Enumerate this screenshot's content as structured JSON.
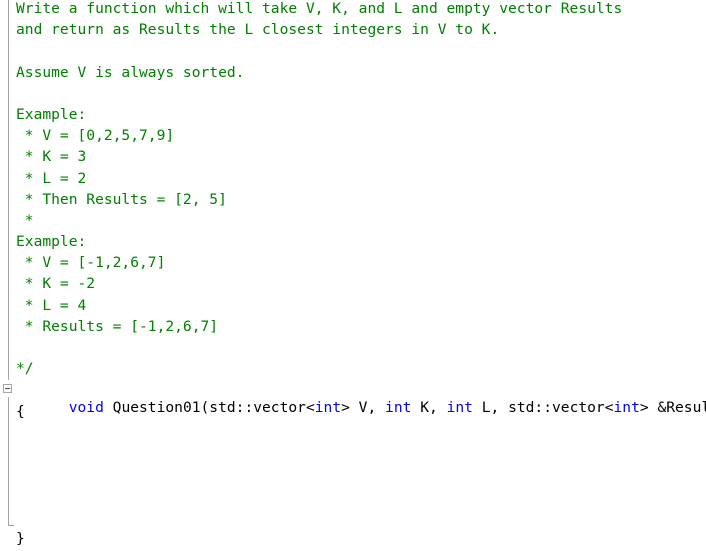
{
  "comment": {
    "lines": [
      "Write a function which will take V, K, and L and empty vector Results",
      "and return as Results the L closest integers in V to K.",
      "",
      "Assume V is always sorted.",
      "",
      "Example:",
      " * V = [0,2,5,7,9]",
      " * K = 3",
      " * L = 2",
      " * Then Results = [2, 5]",
      " *",
      "Example:",
      " * V = [-1,2,6,7]",
      " * K = -2",
      " * L = 4",
      " * Results = [-1,2,6,7]",
      "",
      "*/"
    ]
  },
  "function": {
    "signature_tokens": [
      {
        "text": "void",
        "kind": "keyword"
      },
      {
        "text": " Question01(std::vector<",
        "kind": "plain"
      },
      {
        "text": "int",
        "kind": "keyword"
      },
      {
        "text": "> V, ",
        "kind": "plain"
      },
      {
        "text": "int",
        "kind": "keyword"
      },
      {
        "text": " K, ",
        "kind": "plain"
      },
      {
        "text": "int",
        "kind": "keyword"
      },
      {
        "text": " L, std::vector<",
        "kind": "plain"
      },
      {
        "text": "int",
        "kind": "keyword"
      },
      {
        "text": "> &Results)",
        "kind": "plain"
      }
    ],
    "open_brace": "{",
    "body_lines": [
      "",
      "",
      "",
      "",
      ""
    ],
    "close_brace": "}"
  },
  "colors": {
    "comment": "#008000",
    "keyword": "#0000ff",
    "plain": "#000000",
    "fold_guide": "#a5a5a5"
  }
}
